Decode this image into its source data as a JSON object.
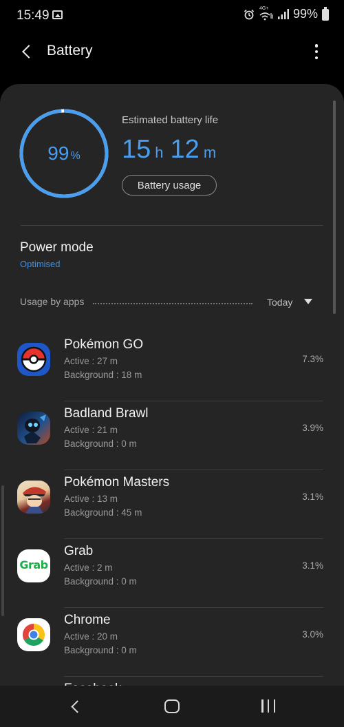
{
  "status_bar": {
    "time": "15:49",
    "battery_percent": "99%",
    "network_label": "4G+",
    "icons": [
      "gallery-icon",
      "alarm-icon",
      "wifi-icon",
      "signal-icon",
      "battery-icon"
    ]
  },
  "app_bar": {
    "title": "Battery",
    "icons": [
      "back-icon",
      "more-options-icon"
    ]
  },
  "battery": {
    "level_value": "99",
    "level_unit": "%",
    "level_fraction": 0.99,
    "ring_color": "#4a9ef0",
    "estimated_label": "Estimated battery life",
    "hours": "15",
    "hours_unit": "h",
    "minutes": "12",
    "minutes_unit": "m",
    "usage_button": "Battery usage"
  },
  "power_mode": {
    "title": "Power mode",
    "value": "Optimised",
    "value_color": "#3e91e6"
  },
  "usage": {
    "label": "Usage by apps",
    "period": "Today",
    "apps": [
      {
        "name": "Pokémon GO",
        "active": "Active : 27 m",
        "background": "Background : 18 m",
        "percent": "7.3%",
        "icon": "pokeball-icon"
      },
      {
        "name": "Badland Brawl",
        "active": "Active : 21 m",
        "background": "Background : 0 m",
        "percent": "3.9%",
        "icon": "badland-brawl-icon"
      },
      {
        "name": "Pokémon Masters",
        "active": "Active : 13 m",
        "background": "Background : 45 m",
        "percent": "3.1%",
        "icon": "pokemon-masters-icon"
      },
      {
        "name": "Grab",
        "active": "Active : 2 m",
        "background": "Background : 0 m",
        "percent": "3.1%",
        "icon": "grab-icon",
        "icon_text": "Grab"
      },
      {
        "name": "Chrome",
        "active": "Active : 20 m",
        "background": "Background : 0 m",
        "percent": "3.0%",
        "icon": "chrome-icon"
      },
      {
        "name": "Facebook",
        "icon": "facebook-icon"
      }
    ]
  },
  "nav_bar": {
    "icons": [
      "nav-back-icon",
      "nav-home-icon",
      "nav-recents-icon"
    ]
  }
}
